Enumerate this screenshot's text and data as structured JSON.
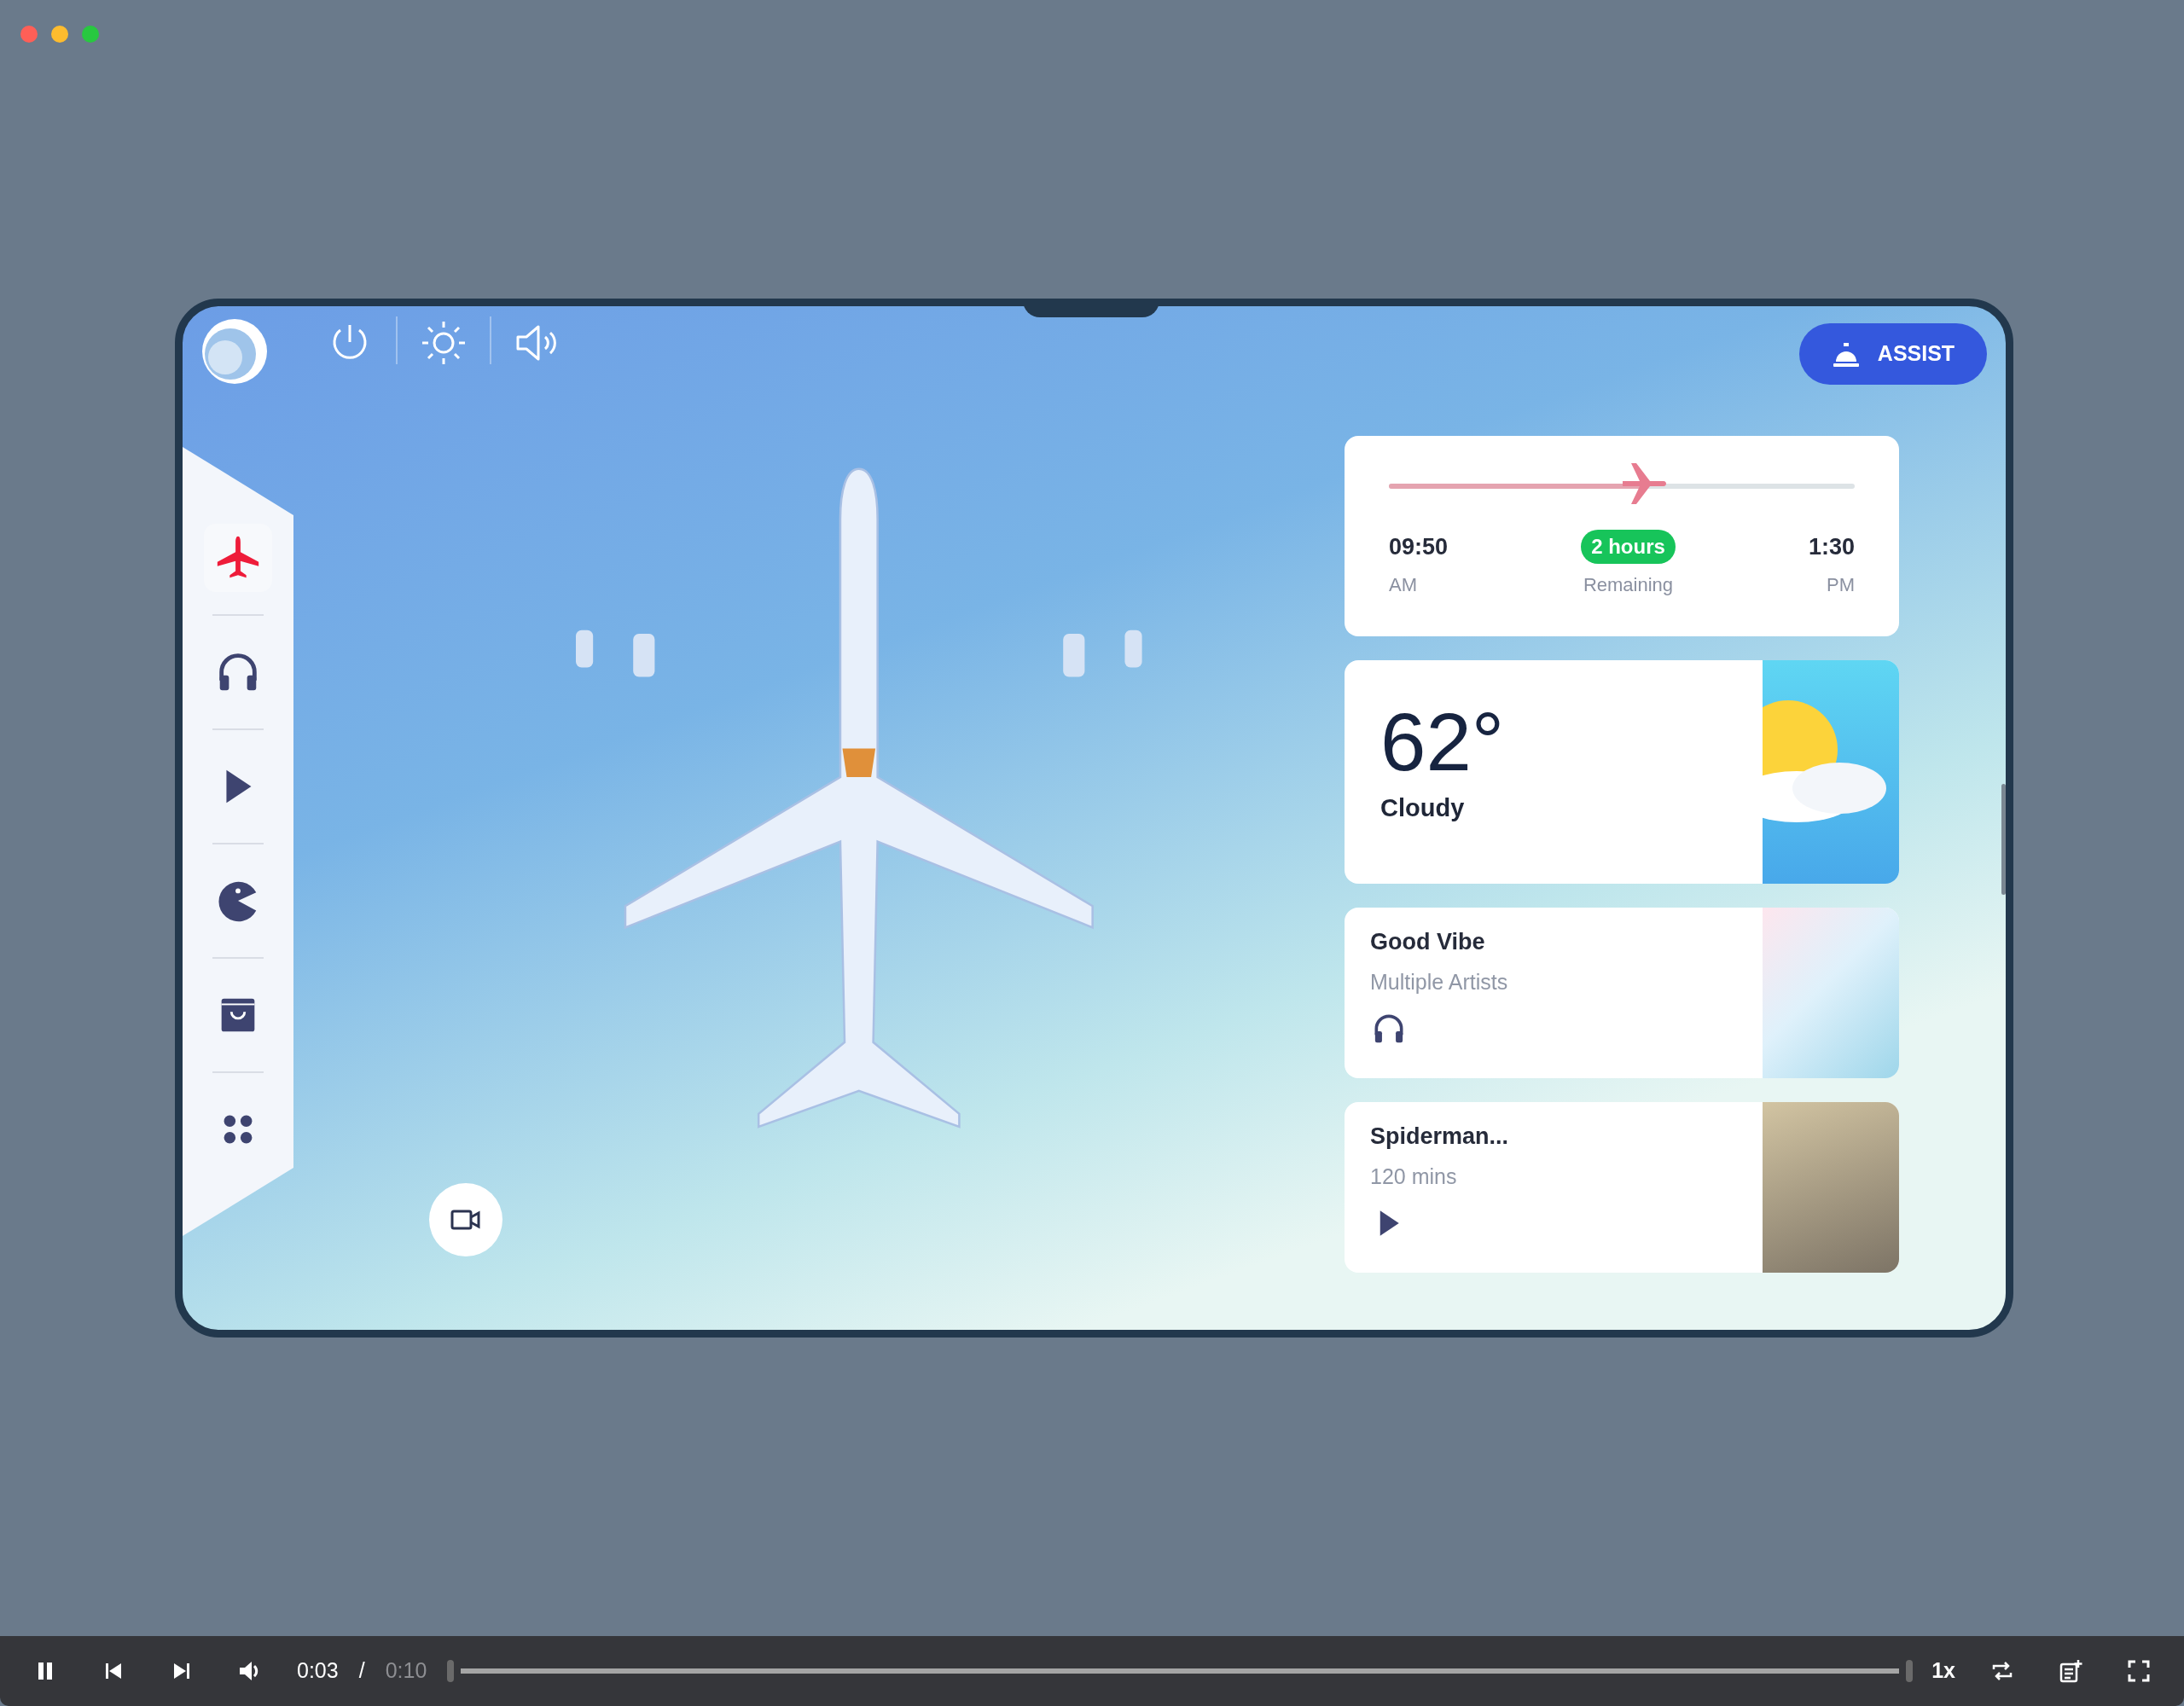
{
  "window": {
    "controls": [
      {
        "color": "#fe5f57"
      },
      {
        "color": "#febc2e"
      },
      {
        "color": "#28c840"
      }
    ]
  },
  "device": {
    "top_bar": {
      "assist_button": "ASSIST"
    },
    "sidebar": {
      "items": [
        {
          "kind": "flight",
          "selected": true
        },
        {
          "kind": "music",
          "selected": false
        },
        {
          "kind": "movies",
          "selected": false
        },
        {
          "kind": "games",
          "selected": false
        },
        {
          "kind": "shop",
          "selected": false
        },
        {
          "kind": "apps",
          "selected": false
        }
      ]
    },
    "flight": {
      "level": 0.55,
      "depart_time": "09:50",
      "depart_period": "AM",
      "remaining": "2 hours",
      "remaining_label": "Remaining",
      "arrive_time": "1:30",
      "arrive_period": "PM"
    },
    "weather": {
      "temperature": "62°",
      "condition": "Cloudy"
    },
    "music": {
      "title": "Good Vibe",
      "subtitle": "Multiple Artists"
    },
    "movie": {
      "title": "Spiderman...",
      "subtitle": "120 mins"
    }
  },
  "player": {
    "playing": true,
    "current_time": "0:03",
    "separator": "/",
    "duration": "0:10",
    "speed": "1x"
  }
}
